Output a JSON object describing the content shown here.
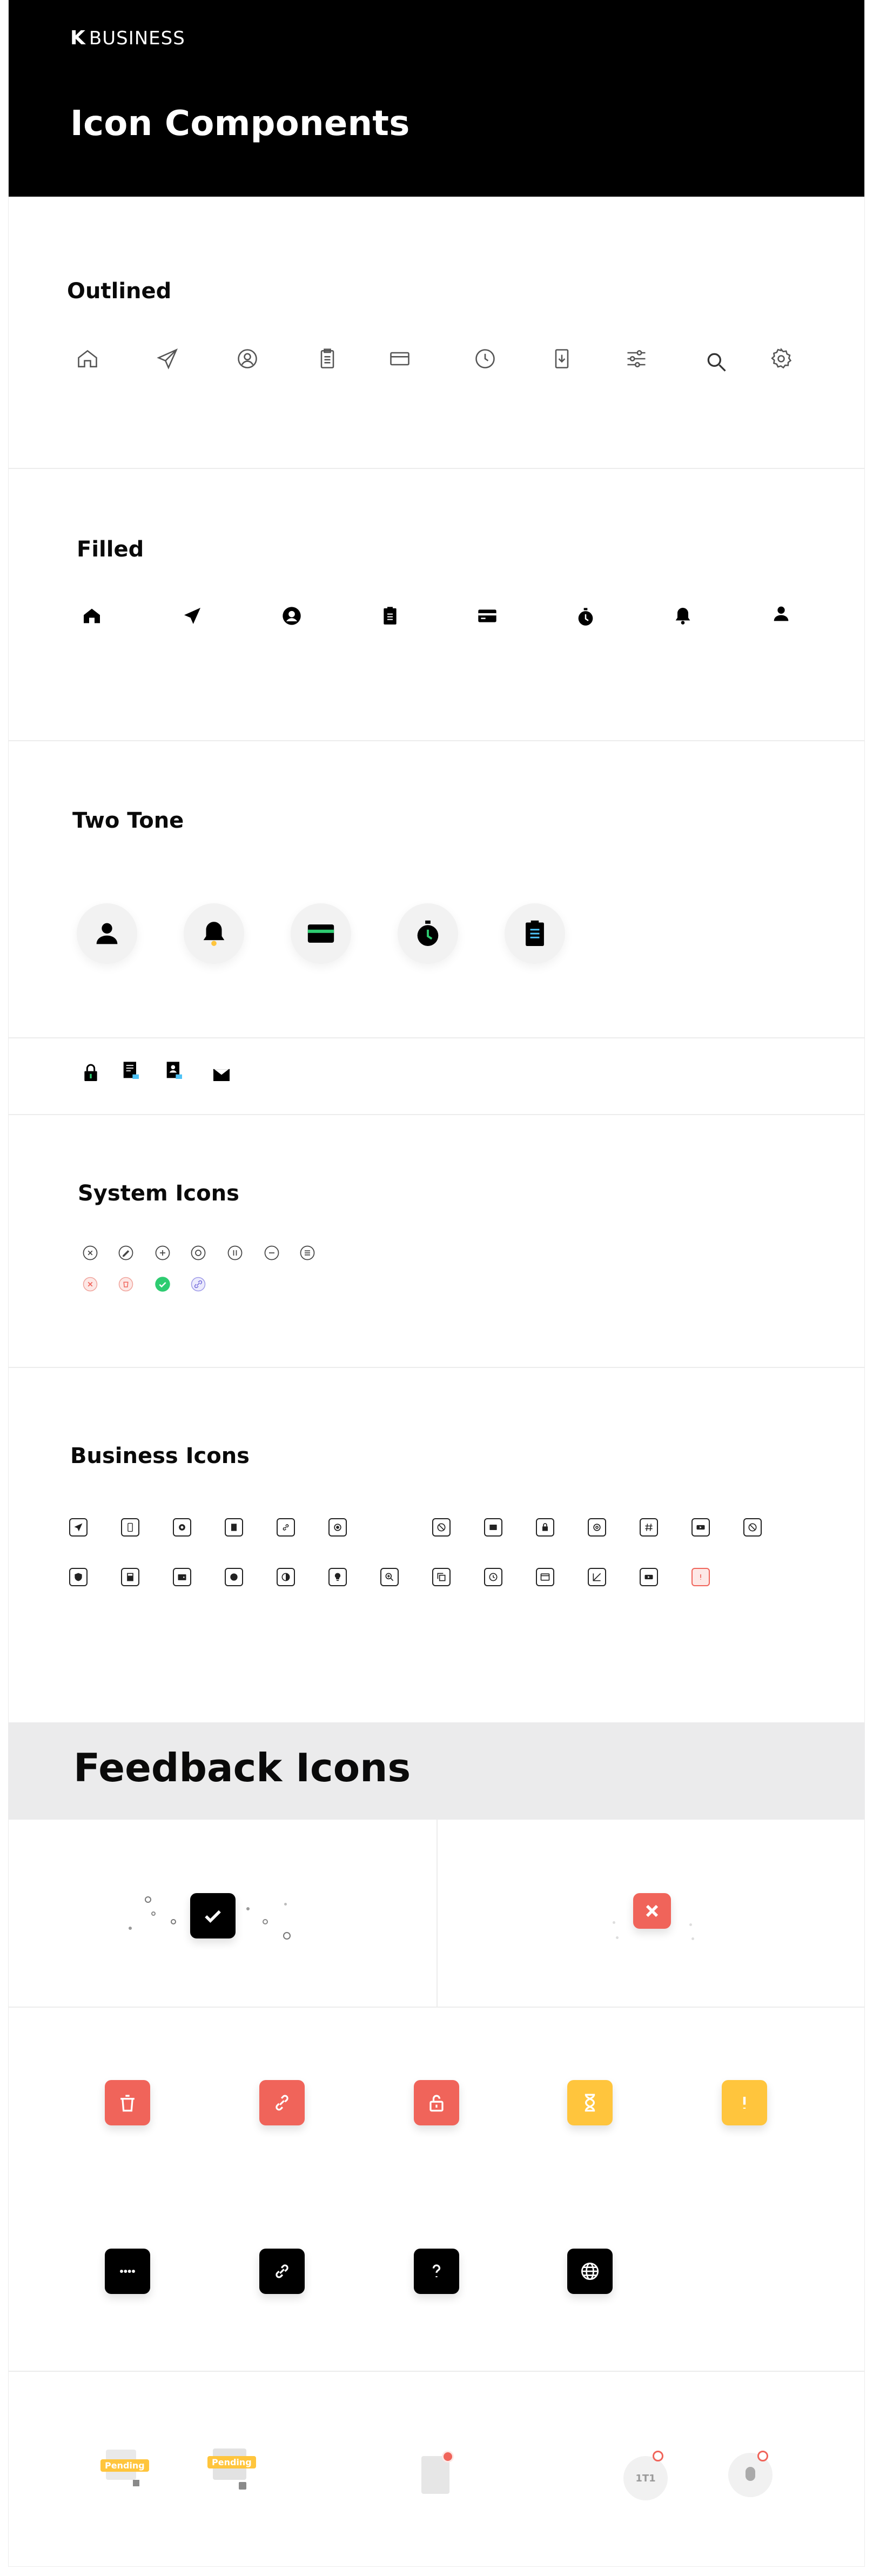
{
  "brand": {
    "logo_glyph": "K",
    "name": "BUSINESS"
  },
  "page": {
    "title": "Icon Components"
  },
  "sections": {
    "outlined": "Outlined",
    "filled": "Filled",
    "two_tone": "Two Tone",
    "system": "System Icons",
    "business": "Business Icons",
    "feedback": "Feedback Icons"
  },
  "outlined_icons": [
    "home-icon",
    "send-icon",
    "user-circle-icon",
    "clipboard-icon",
    "credit-card-icon",
    "clock-icon",
    "file-download-icon",
    "sliders-icon",
    "search-icon",
    "settings-icon"
  ],
  "filled_icons": [
    "home-icon",
    "send-icon",
    "user-circle-icon",
    "clipboard-icon",
    "credit-card-icon",
    "stopwatch-icon",
    "bell-icon",
    "user-icon"
  ],
  "two_tone_icons": [
    "user-icon",
    "bell-icon",
    "credit-card-icon",
    "stopwatch-icon",
    "clipboard-icon"
  ],
  "system_icons_row1": [
    "close-circle-icon",
    "edit-circle-icon",
    "add-circle-icon",
    "radio-circle-icon",
    "pause-circle-icon",
    "minus-circle-icon",
    "list-circle-icon"
  ],
  "system_icons_row2": [
    "close-circle-red-icon",
    "delete-circle-red-icon",
    "check-circle-green-icon",
    "link-circle-purple-icon"
  ],
  "feedback": {
    "pending_label": "Pending",
    "colors": {
      "red": "#f0645a",
      "yellow": "#ffc53d",
      "green": "#2ecc71",
      "black": "#000000"
    }
  }
}
